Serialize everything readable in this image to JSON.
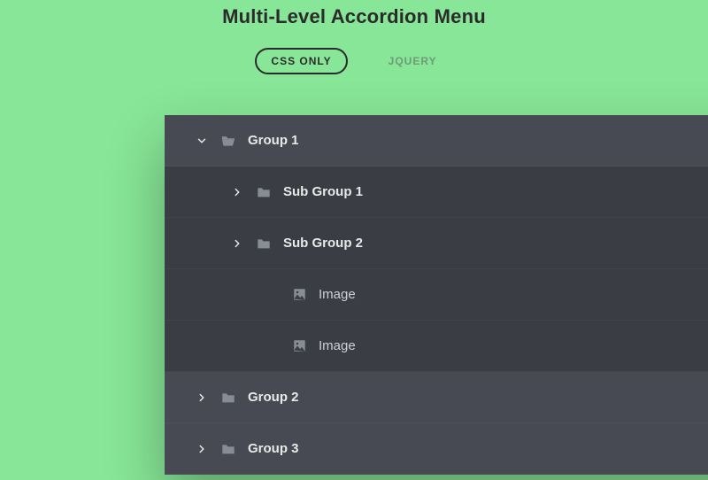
{
  "header": {
    "title": "Multi-Level Accordion Menu",
    "tabs": {
      "css_only": "CSS ONLY",
      "jquery": "JQUERY"
    }
  },
  "menu": {
    "items": [
      {
        "label": "Group 1",
        "level": 0,
        "expanded": true
      },
      {
        "label": "Sub Group 1",
        "level": 1,
        "expanded": false
      },
      {
        "label": "Sub Group 2",
        "level": 1,
        "expanded": false
      },
      {
        "label": "Image",
        "level": 2
      },
      {
        "label": "Image",
        "level": 2
      },
      {
        "label": "Group 2",
        "level": 0,
        "expanded": false
      },
      {
        "label": "Group 3",
        "level": 0,
        "expanded": false
      }
    ]
  }
}
